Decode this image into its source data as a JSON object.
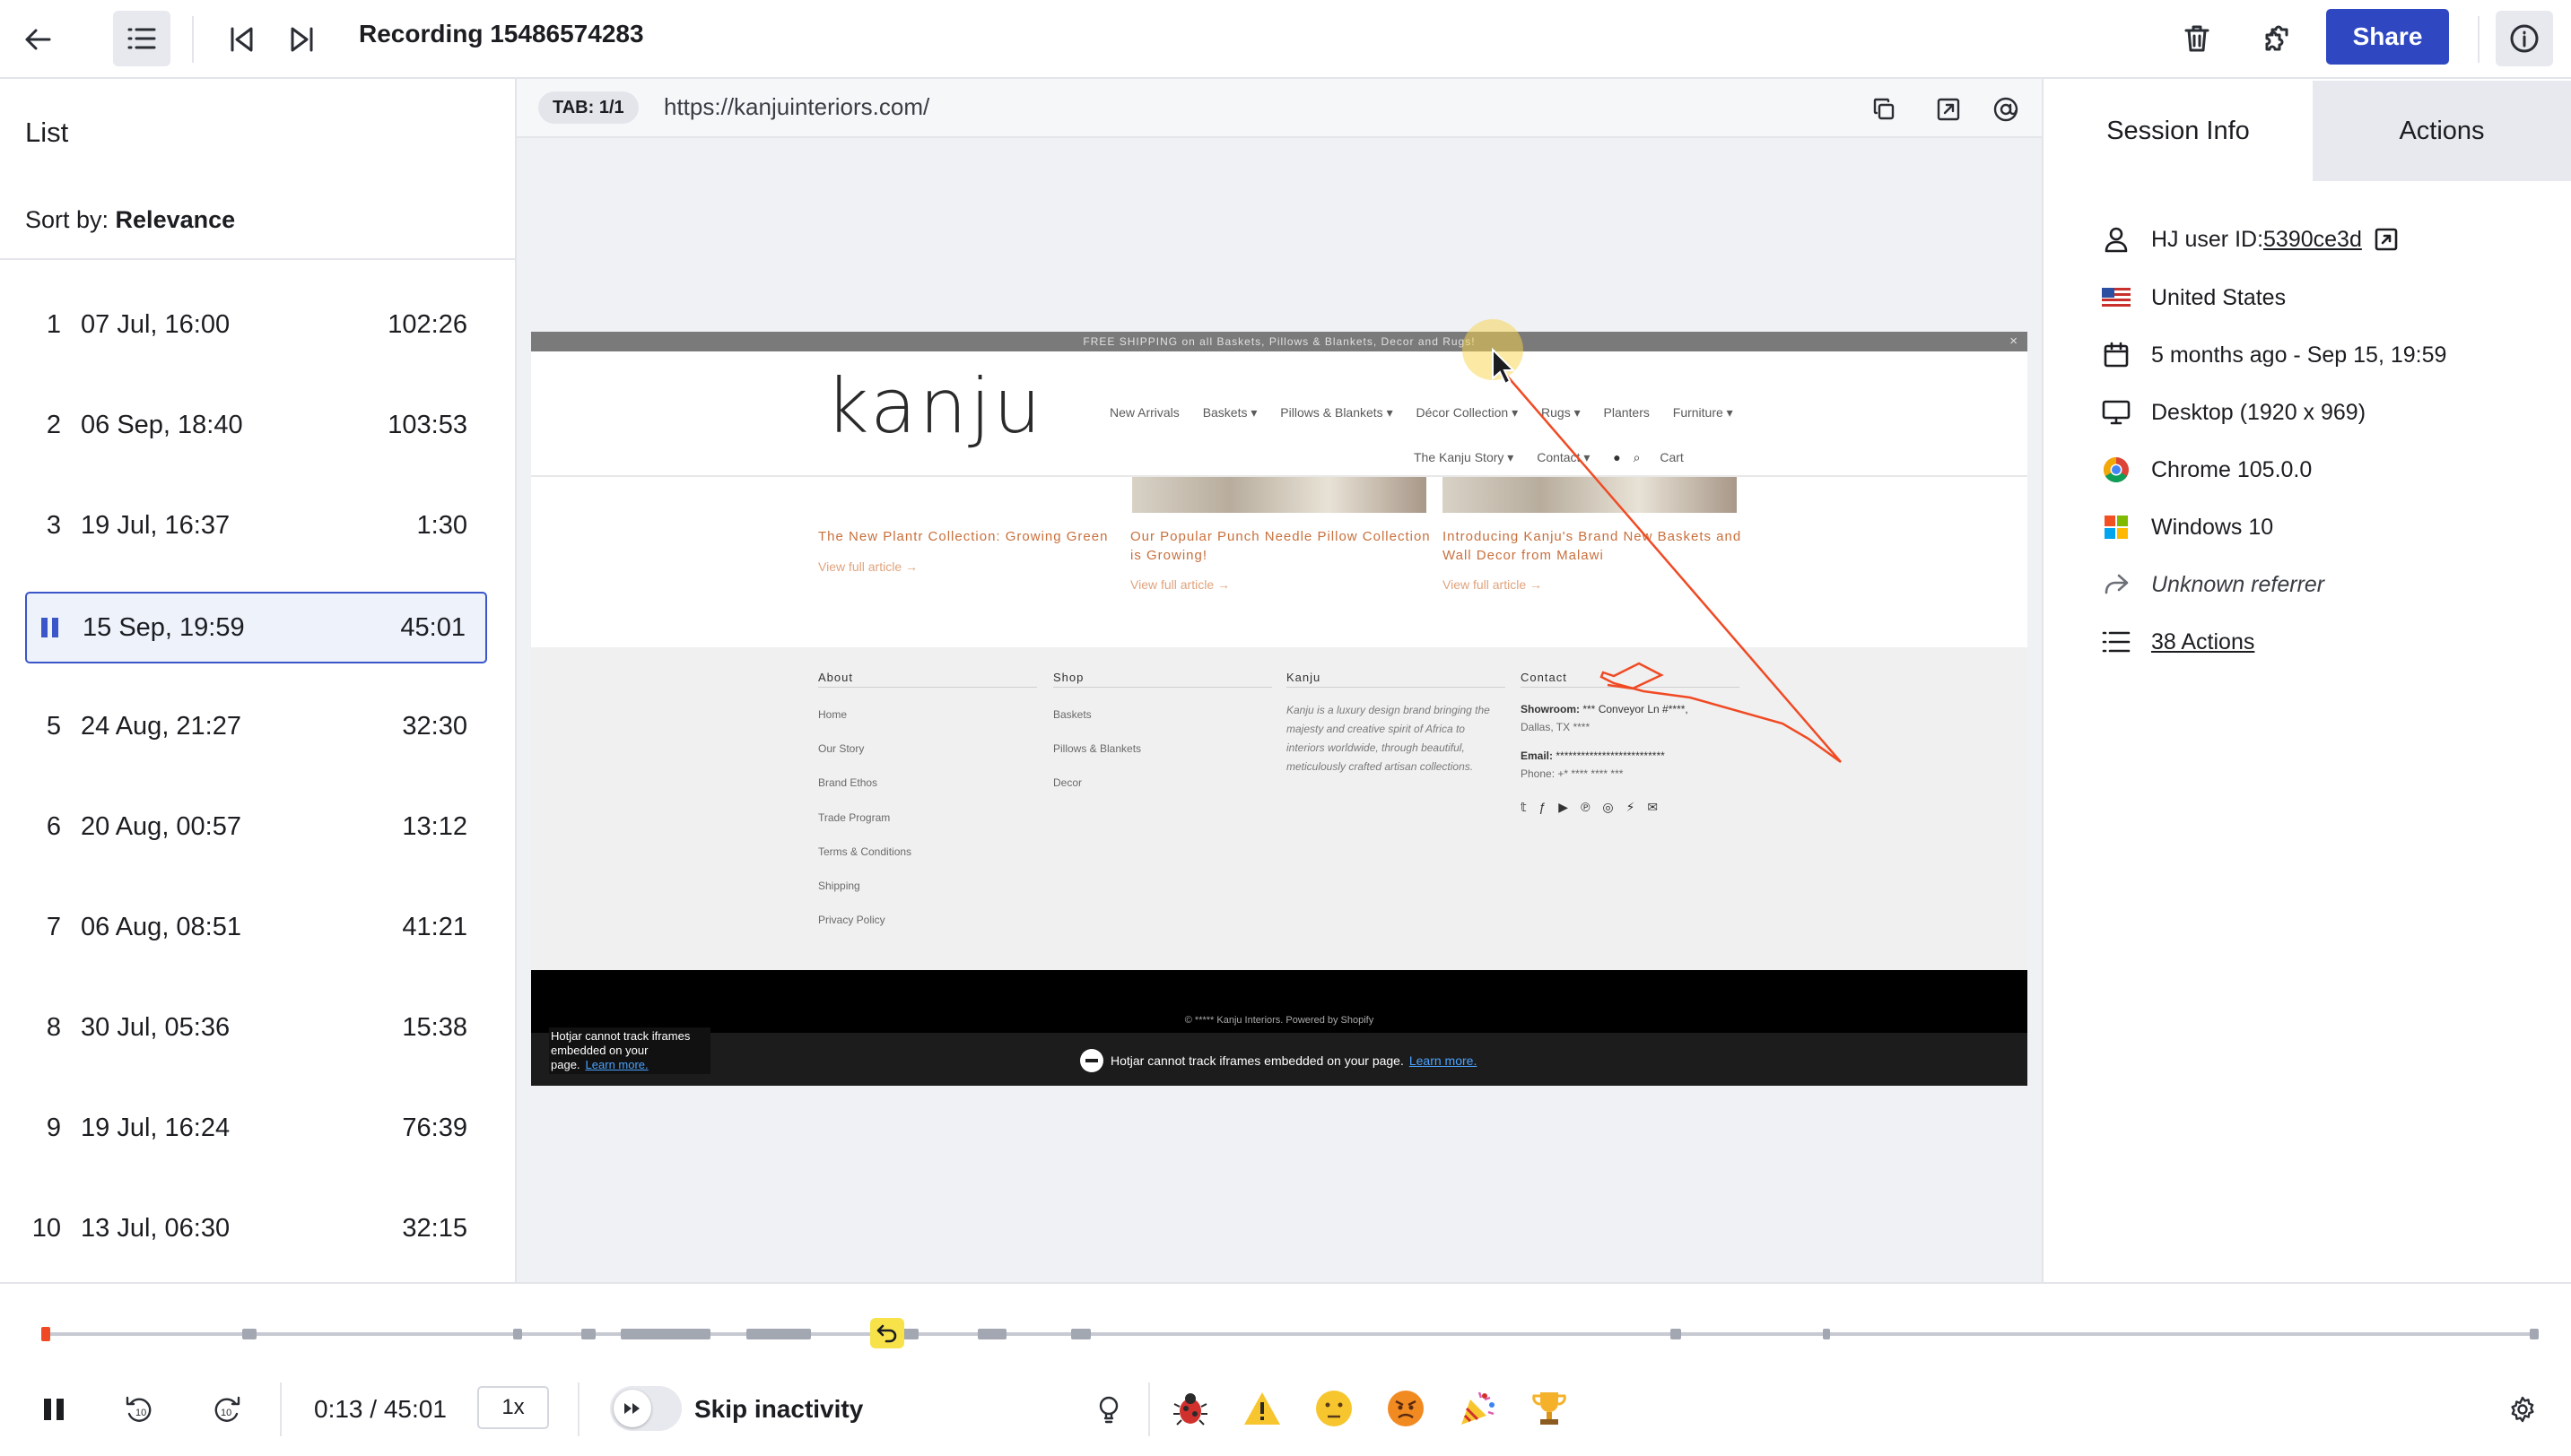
{
  "header": {
    "title": "Recording 15486574283",
    "share_label": "Share"
  },
  "list": {
    "title": "List",
    "sort_prefix": "Sort by: ",
    "sort_value": "Relevance",
    "items": [
      {
        "num": "1",
        "date": "07 Jul, 16:00",
        "duration": "102:26"
      },
      {
        "num": "2",
        "date": "06 Sep, 18:40",
        "duration": "103:53"
      },
      {
        "num": "3",
        "date": "19 Jul, 16:37",
        "duration": "1:30"
      },
      {
        "num": "",
        "date": "15 Sep, 19:59",
        "duration": "45:01",
        "active": true
      },
      {
        "num": "5",
        "date": "24 Aug, 21:27",
        "duration": "32:30"
      },
      {
        "num": "6",
        "date": "20 Aug, 00:57",
        "duration": "13:12"
      },
      {
        "num": "7",
        "date": "06 Aug, 08:51",
        "duration": "41:21"
      },
      {
        "num": "8",
        "date": "30 Jul, 05:36",
        "duration": "15:38"
      },
      {
        "num": "9",
        "date": "19 Jul, 16:24",
        "duration": "76:39"
      },
      {
        "num": "10",
        "date": "13 Jul, 06:30",
        "duration": "32:15"
      }
    ]
  },
  "viewer": {
    "tab_badge": "TAB: 1/1",
    "url": "https://kanjuinteriors.com/"
  },
  "site": {
    "banner": "FREE SHIPPING on all Baskets, Pillows & Blankets, Decor and Rugs!",
    "banner_close": "×",
    "logo": "kanju",
    "nav_row1": [
      "New Arrivals",
      "Baskets ▾",
      "Pillows & Blankets ▾",
      "Décor Collection ▾",
      "Rugs ▾",
      "Planters",
      "Furniture ▾"
    ],
    "nav_row2": [
      "The Kanju Story ▾",
      "Contact ▾",
      "Cart"
    ],
    "blog": [
      {
        "title": "The New Plantr Collection: Growing Green",
        "link": "View full article →"
      },
      {
        "title": "Our Popular Punch Needle Pillow Collection is Growing!",
        "link": "View full article →"
      },
      {
        "title": "Introducing Kanju's Brand New Baskets and Wall Decor from Malawi",
        "link": "View full article →"
      }
    ],
    "footer": {
      "about_title": "About",
      "about_links": [
        "Home",
        "Our Story",
        "Brand Ethos",
        "Trade Program",
        "Terms & Conditions",
        "Shipping",
        "Privacy Policy"
      ],
      "shop_title": "Shop",
      "shop_links": [
        "Baskets",
        "Pillows & Blankets",
        "Decor"
      ],
      "kanju_title": "Kanju",
      "kanju_text": "Kanju is a luxury design brand bringing the majesty and creative spirit of Africa to interiors worldwide, through beautiful, meticulously crafted artisan collections.",
      "contact_title": "Contact",
      "showroom_label": "Showroom:",
      "showroom_value": "*** Conveyor Ln #****,",
      "showroom_city": "Dallas, TX ****",
      "email_label": "Email:",
      "email_value": "**************************",
      "phone": "Phone: +* **** **** ***"
    },
    "copyright": "© ***** Kanju Interiors. Powered by Shopify",
    "hj_notice_left": "Hotjar cannot track iframes embedded on your page.",
    "hj_notice": "Hotjar cannot track iframes embedded on your page.",
    "hj_learn": "Learn more."
  },
  "session": {
    "tab_info": "Session Info",
    "tab_actions": "Actions",
    "user_id_label": "HJ user ID: ",
    "user_id": "5390ce3d",
    "country": "United States",
    "date": "5 months ago - Sep 15, 19:59",
    "device": "Desktop (1920 x 969)",
    "browser": "Chrome 105.0.0",
    "os": "Windows 10",
    "referrer": "Unknown referrer",
    "actions": "38 Actions"
  },
  "player": {
    "time": "0:13 / 45:01",
    "speed": "1x",
    "skip_label": "Skip inactivity"
  },
  "colors": {
    "accent": "#2f48c2",
    "active_row_bg": "#eef2fb",
    "cursor_trail": "#f04a24"
  }
}
